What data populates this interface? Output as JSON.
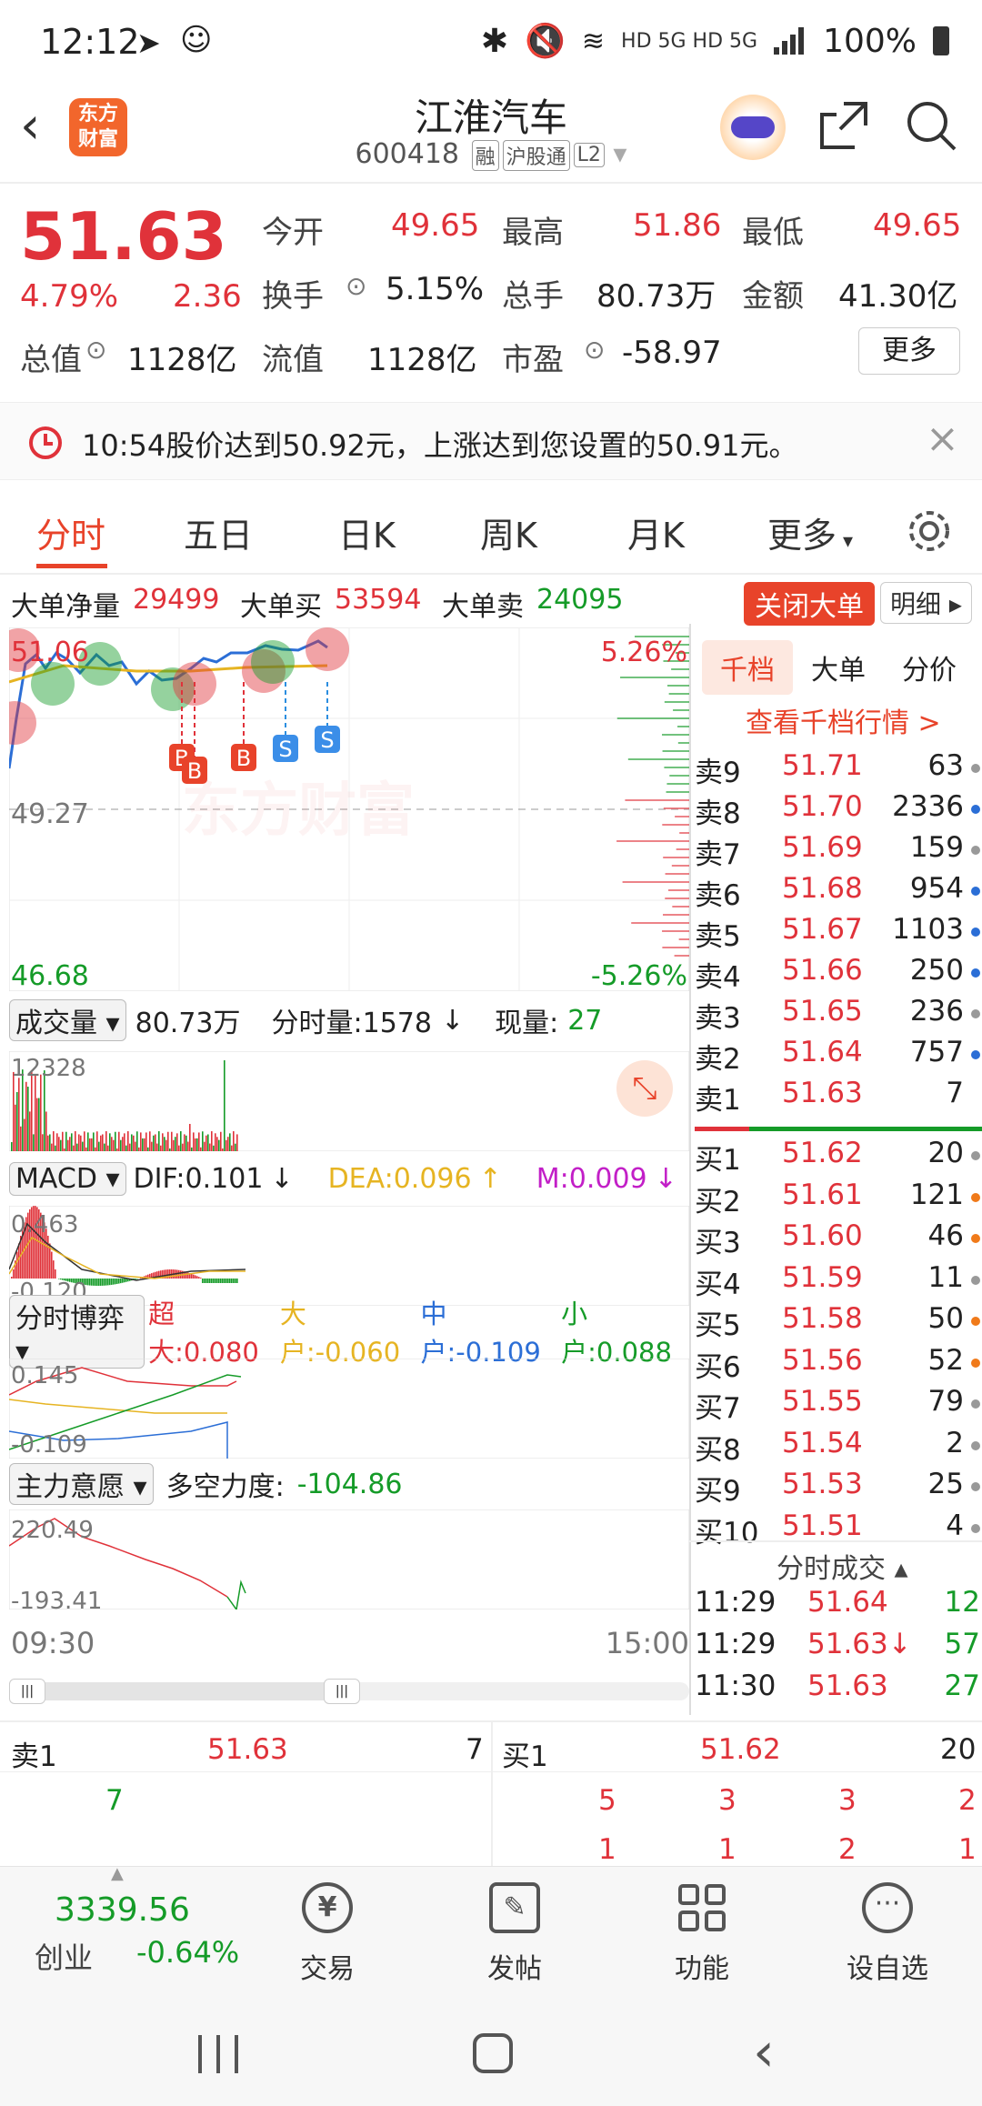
{
  "status_bar": {
    "time": "12:12",
    "network": "HD 5G HD 5G",
    "battery": "100%"
  },
  "header": {
    "logo": "东方财富",
    "name": "江淮汽车",
    "code": "600418",
    "tags": [
      "融",
      "沪股通",
      "L2"
    ]
  },
  "quote": {
    "price": "51.63",
    "pct": "4.79%",
    "change": "2.36",
    "open_label": "今开",
    "open": "49.65",
    "high_label": "最高",
    "high": "51.86",
    "low_label": "最低",
    "low": "49.65",
    "turnover_label": "换手",
    "turnover": "5.15%",
    "volume_label": "总手",
    "volume": "80.73万",
    "amount_label": "金额",
    "amount": "41.30亿",
    "mcap_label": "总值",
    "mcap": "1128亿",
    "float_label": "流值",
    "float": "1128亿",
    "pe_label": "市盈",
    "pe": "-58.97",
    "more": "更多"
  },
  "alert": {
    "text": "10:54股价达到50.92元，上涨达到您设置的50.91元。"
  },
  "tabs": [
    "分时",
    "五日",
    "日K",
    "周K",
    "月K",
    "更多"
  ],
  "big_order": {
    "net_label": "大单净量",
    "net": "29499",
    "buy_label": "大单买",
    "buy": "53594",
    "sell_label": "大单卖",
    "sell": "24095",
    "close_btn": "关闭大单",
    "detail_btn": "明细"
  },
  "chart": {
    "top_left": "51.06",
    "top_right": "5.26%",
    "mid": "49.27",
    "bottom_left": "46.68",
    "bottom_right": "-5.26%",
    "markers": [
      "B",
      "B",
      "B",
      "S",
      "S"
    ],
    "vol_label": "成交量",
    "vol_total": "80.73万",
    "vol_min_label": "分时量:1578",
    "vol_now_label": "现量:",
    "vol_now": "27",
    "vol_max": "12328",
    "macd_label": "MACD",
    "dif": "DIF:0.101",
    "dea": "DEA:0.096",
    "m": "M:0.009",
    "macd_top": "0.463",
    "macd_bot": "-0.120",
    "flow_label": "分时博弈",
    "flow_xl": "超大:0.080",
    "flow_l": "大户:-0.060",
    "flow_m": "中户:-0.109",
    "flow_s": "小户:0.088",
    "flow_top": "0.145",
    "flow_bot": "-0.109",
    "main_label": "主力意愿",
    "main_val_label": "多空力度:",
    "main_val": "-104.86",
    "main_top": "220.49",
    "main_bot": "-193.41",
    "time_start": "09:30",
    "time_end": "15:00",
    "colors": {
      "price_line": "#2b6ed6",
      "avg_line": "#e6b422",
      "up": "#e0323a",
      "down": "#159b28"
    }
  },
  "order_book": {
    "tabs": [
      "千档",
      "大单",
      "分价"
    ],
    "link": "查看千档行情 >",
    "asks": [
      {
        "n": "卖9",
        "p": "51.71",
        "v": "63",
        "c": "#999"
      },
      {
        "n": "卖8",
        "p": "51.70",
        "v": "2336",
        "c": "#2b6ed6"
      },
      {
        "n": "卖7",
        "p": "51.69",
        "v": "159",
        "c": "#999"
      },
      {
        "n": "卖6",
        "p": "51.68",
        "v": "954",
        "c": "#2b6ed6"
      },
      {
        "n": "卖5",
        "p": "51.67",
        "v": "1103",
        "c": "#2b6ed6"
      },
      {
        "n": "卖4",
        "p": "51.66",
        "v": "250",
        "c": "#2b6ed6"
      },
      {
        "n": "卖3",
        "p": "51.65",
        "v": "236",
        "c": "#999"
      },
      {
        "n": "卖2",
        "p": "51.64",
        "v": "757",
        "c": "#2b6ed6"
      },
      {
        "n": "卖1",
        "p": "51.63",
        "v": "7",
        "c": "#fff"
      }
    ],
    "bids": [
      {
        "n": "买1",
        "p": "51.62",
        "v": "20",
        "c": "#999"
      },
      {
        "n": "买2",
        "p": "51.61",
        "v": "121",
        "c": "#f07a1a"
      },
      {
        "n": "买3",
        "p": "51.60",
        "v": "46",
        "c": "#f07a1a"
      },
      {
        "n": "买4",
        "p": "51.59",
        "v": "11",
        "c": "#999"
      },
      {
        "n": "买5",
        "p": "51.58",
        "v": "50",
        "c": "#f07a1a"
      },
      {
        "n": "买6",
        "p": "51.56",
        "v": "52",
        "c": "#f07a1a"
      },
      {
        "n": "买7",
        "p": "51.55",
        "v": "79",
        "c": "#999"
      },
      {
        "n": "买8",
        "p": "51.54",
        "v": "2",
        "c": "#999"
      },
      {
        "n": "买9",
        "p": "51.53",
        "v": "25",
        "c": "#999"
      },
      {
        "n": "买10",
        "p": "51.51",
        "v": "4",
        "c": "#999"
      }
    ],
    "ticks_title": "分时成交",
    "ticks": [
      {
        "t": "11:29",
        "p": "51.64",
        "v": "12"
      },
      {
        "t": "11:29",
        "p": "51.63↓",
        "v": "57"
      },
      {
        "t": "11:30",
        "p": "51.63",
        "v": "27"
      }
    ]
  },
  "l2_queue": {
    "ask_label": "卖1",
    "ask_price": "51.63",
    "ask_vol": "7",
    "ask_queue": [
      "7"
    ],
    "bid_label": "买1",
    "bid_price": "51.62",
    "bid_vol": "20",
    "bid_queue": [
      "5",
      "3",
      "3",
      "2",
      "1",
      "1",
      "2",
      "1"
    ]
  },
  "bottom_nav": {
    "index_val": "3339.56",
    "index_name": "创业",
    "index_pct": "-0.64%",
    "items": [
      "交易",
      "发帖",
      "功能",
      "设自选"
    ]
  }
}
